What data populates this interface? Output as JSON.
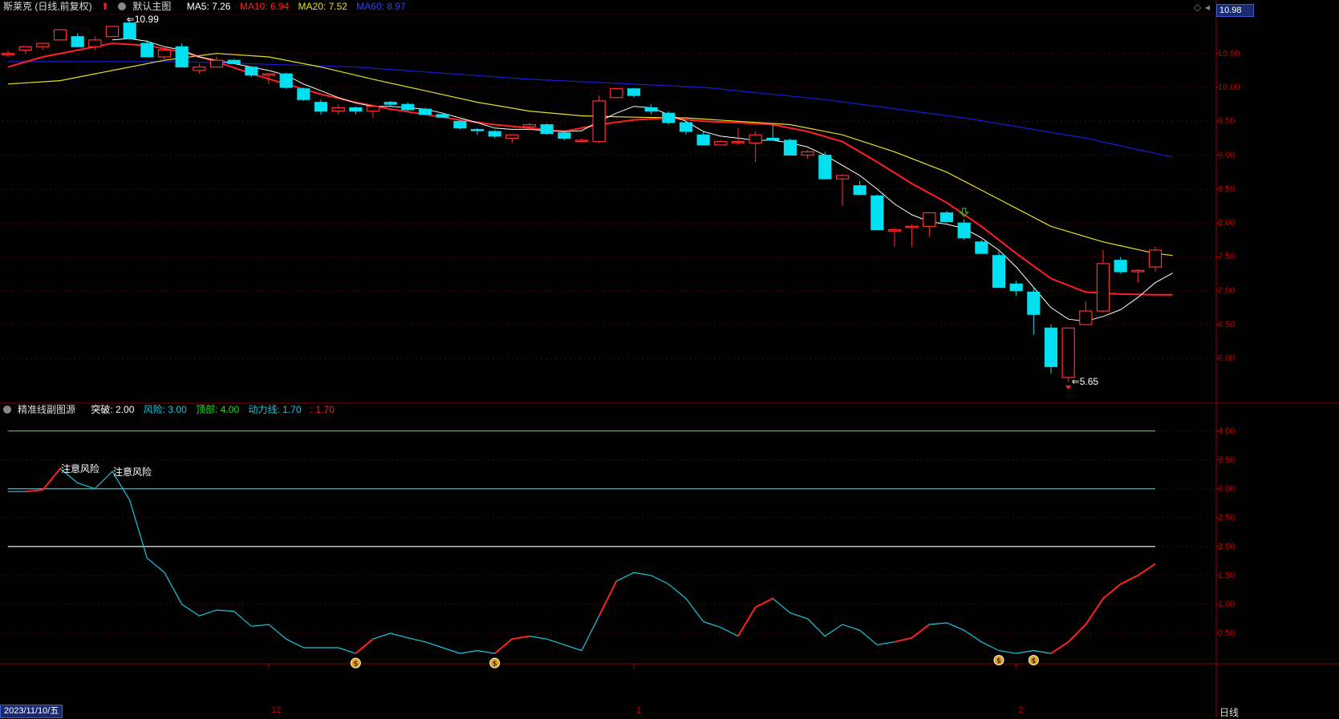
{
  "main_header": {
    "stock_name": "斯莱克 (日线,前复权)",
    "template": "默认主图",
    "ma5": "MA5: 7.26",
    "ma10": "MA10: 6.94",
    "ma20": "MA20: 7.52",
    "ma60": "MA60: 8.97"
  },
  "sub_header": {
    "indicator": "精准线副图源",
    "breakout": "突破: 2.00",
    "risk": "风险: 3.00",
    "top": "顶部: 4.00",
    "momentum": "动力线: 1.70",
    "extra": ": 1.70"
  },
  "current_price_tag": "10.98",
  "price_axis_labels": [
    "10.50",
    "10.00",
    "9.50",
    "9.00",
    "8.50",
    "8.00",
    "7.50",
    "7.00",
    "6.50",
    "6.00"
  ],
  "indicator_axis_labels": [
    "4.00",
    "3.50",
    "3.00",
    "2.50",
    "2.00",
    "1.50",
    "1.00",
    "0.50"
  ],
  "date_tag": "2023/11/10/五",
  "x_labels": [
    "12",
    "1",
    "2"
  ],
  "period_label": "日线",
  "annotations": {
    "high_label": "10.99",
    "low_label": "5.65",
    "risk_note_1": "注意风险",
    "risk_note_2": "注意风险"
  },
  "colors": {
    "ma5": "#ffffff",
    "ma10": "#ff2020",
    "ma20": "#e8e020",
    "ma60": "#1a1ad8",
    "up": "#ff3030",
    "down": "#00e0f0",
    "grid": "#5a0000"
  },
  "chart_data": {
    "type": "candlestick",
    "price_range": [
      5.4,
      11.1
    ],
    "indicator_range": [
      0.0,
      4.3
    ],
    "candles": [
      [
        10.5,
        10.55,
        10.45,
        10.5
      ],
      [
        10.55,
        10.6,
        10.5,
        10.6
      ],
      [
        10.6,
        10.65,
        10.55,
        10.65
      ],
      [
        10.7,
        10.85,
        10.7,
        10.85
      ],
      [
        10.75,
        10.8,
        10.6,
        10.6
      ],
      [
        10.6,
        10.75,
        10.55,
        10.7
      ],
      [
        10.75,
        10.9,
        10.75,
        10.9
      ],
      [
        10.95,
        10.99,
        10.7,
        10.72
      ],
      [
        10.65,
        10.7,
        10.45,
        10.45
      ],
      [
        10.45,
        10.6,
        10.4,
        10.55
      ],
      [
        10.6,
        10.65,
        10.3,
        10.3
      ],
      [
        10.25,
        10.35,
        10.2,
        10.3
      ],
      [
        10.3,
        10.45,
        10.3,
        10.4
      ],
      [
        10.4,
        10.42,
        10.35,
        10.35
      ],
      [
        10.3,
        10.32,
        10.15,
        10.18
      ],
      [
        10.18,
        10.2,
        10.05,
        10.2
      ],
      [
        10.2,
        10.22,
        9.98,
        10.0
      ],
      [
        9.98,
        10.0,
        9.8,
        9.82
      ],
      [
        9.78,
        9.82,
        9.6,
        9.65
      ],
      [
        9.65,
        9.75,
        9.6,
        9.7
      ],
      [
        9.7,
        9.72,
        9.6,
        9.65
      ],
      [
        9.65,
        9.72,
        9.55,
        9.72
      ],
      [
        9.78,
        9.8,
        9.72,
        9.75
      ],
      [
        9.75,
        9.78,
        9.65,
        9.67
      ],
      [
        9.68,
        9.7,
        9.6,
        9.6
      ],
      [
        9.6,
        9.62,
        9.55,
        9.56
      ],
      [
        9.5,
        9.52,
        9.38,
        9.4
      ],
      [
        9.38,
        9.4,
        9.3,
        9.36
      ],
      [
        9.35,
        9.37,
        9.25,
        9.28
      ],
      [
        9.25,
        9.3,
        9.18,
        9.3
      ],
      [
        9.42,
        9.48,
        9.36,
        9.45
      ],
      [
        9.45,
        9.47,
        9.3,
        9.32
      ],
      [
        9.33,
        9.35,
        9.22,
        9.25
      ],
      [
        9.22,
        9.25,
        9.18,
        9.22
      ],
      [
        9.2,
        9.88,
        9.18,
        9.8
      ],
      [
        9.85,
        9.98,
        9.85,
        9.98
      ],
      [
        9.98,
        9.99,
        9.85,
        9.88
      ],
      [
        9.7,
        9.75,
        9.6,
        9.65
      ],
      [
        9.62,
        9.65,
        9.45,
        9.48
      ],
      [
        9.48,
        9.5,
        9.3,
        9.35
      ],
      [
        9.3,
        9.35,
        9.15,
        9.15
      ],
      [
        9.15,
        9.22,
        9.15,
        9.2
      ],
      [
        9.2,
        9.4,
        9.15,
        9.2
      ],
      [
        9.18,
        9.35,
        8.9,
        9.3
      ],
      [
        9.25,
        9.48,
        9.22,
        9.22
      ],
      [
        9.22,
        9.25,
        9.0,
        9.0
      ],
      [
        9.0,
        9.08,
        8.95,
        9.05
      ],
      [
        9.0,
        9.05,
        8.65,
        8.65
      ],
      [
        8.65,
        8.72,
        8.25,
        8.7
      ],
      [
        8.55,
        8.62,
        8.42,
        8.42
      ],
      [
        8.4,
        8.42,
        7.9,
        7.9
      ],
      [
        7.88,
        7.92,
        7.65,
        7.9
      ],
      [
        7.95,
        7.98,
        7.65,
        7.95
      ],
      [
        7.95,
        8.15,
        7.8,
        8.15
      ],
      [
        8.15,
        8.18,
        8.0,
        8.02
      ],
      [
        8.0,
        8.05,
        7.75,
        7.78
      ],
      [
        7.72,
        7.75,
        7.55,
        7.55
      ],
      [
        7.52,
        7.58,
        7.05,
        7.05
      ],
      [
        7.1,
        7.15,
        6.92,
        7.0
      ],
      [
        6.98,
        7.05,
        6.35,
        6.65
      ],
      [
        6.45,
        6.5,
        5.78,
        5.88
      ],
      [
        5.72,
        6.45,
        5.65,
        6.45
      ],
      [
        6.5,
        6.85,
        6.5,
        6.7
      ],
      [
        6.7,
        7.6,
        6.68,
        7.4
      ],
      [
        7.45,
        7.5,
        7.25,
        7.28
      ],
      [
        7.28,
        7.32,
        7.12,
        7.3
      ],
      [
        7.35,
        7.65,
        7.28,
        7.6
      ]
    ],
    "ma5_points": [
      [
        6,
        10.7
      ],
      [
        7,
        10.72
      ],
      [
        8,
        10.68
      ],
      [
        9,
        10.6
      ],
      [
        10,
        10.55
      ],
      [
        11,
        10.45
      ],
      [
        12,
        10.4
      ],
      [
        13,
        10.35
      ],
      [
        14,
        10.3
      ],
      [
        15,
        10.25
      ],
      [
        16,
        10.18
      ],
      [
        17,
        10.05
      ],
      [
        18,
        9.95
      ],
      [
        19,
        9.85
      ],
      [
        20,
        9.77
      ],
      [
        21,
        9.72
      ],
      [
        22,
        9.72
      ],
      [
        23,
        9.7
      ],
      [
        24,
        9.68
      ],
      [
        25,
        9.62
      ],
      [
        26,
        9.55
      ],
      [
        27,
        9.48
      ],
      [
        28,
        9.4
      ],
      [
        29,
        9.38
      ],
      [
        30,
        9.38
      ],
      [
        31,
        9.36
      ],
      [
        32,
        9.35
      ],
      [
        33,
        9.36
      ],
      [
        34,
        9.5
      ],
      [
        35,
        9.62
      ],
      [
        36,
        9.72
      ],
      [
        37,
        9.7
      ],
      [
        38,
        9.6
      ],
      [
        39,
        9.5
      ],
      [
        40,
        9.35
      ],
      [
        41,
        9.28
      ],
      [
        42,
        9.25
      ],
      [
        43,
        9.22
      ],
      [
        44,
        9.22
      ],
      [
        45,
        9.18
      ],
      [
        46,
        9.12
      ],
      [
        47,
        9.0
      ],
      [
        48,
        8.85
      ],
      [
        49,
        8.7
      ],
      [
        50,
        8.5
      ],
      [
        51,
        8.28
      ],
      [
        52,
        8.12
      ],
      [
        53,
        8.02
      ],
      [
        54,
        7.98
      ],
      [
        55,
        7.92
      ],
      [
        56,
        7.78
      ],
      [
        57,
        7.6
      ],
      [
        58,
        7.35
      ],
      [
        59,
        7.05
      ],
      [
        60,
        6.75
      ],
      [
        61,
        6.58
      ],
      [
        62,
        6.55
      ],
      [
        63,
        6.62
      ],
      [
        64,
        6.72
      ],
      [
        65,
        6.9
      ],
      [
        66,
        7.12
      ],
      [
        67,
        7.26
      ]
    ],
    "ma10_points": [
      [
        0,
        10.3
      ],
      [
        2,
        10.45
      ],
      [
        4,
        10.55
      ],
      [
        6,
        10.65
      ],
      [
        8,
        10.62
      ],
      [
        10,
        10.52
      ],
      [
        12,
        10.38
      ],
      [
        14,
        10.2
      ],
      [
        16,
        10.05
      ],
      [
        18,
        9.9
      ],
      [
        20,
        9.78
      ],
      [
        22,
        9.68
      ],
      [
        24,
        9.6
      ],
      [
        26,
        9.52
      ],
      [
        28,
        9.45
      ],
      [
        30,
        9.4
      ],
      [
        32,
        9.35
      ],
      [
        34,
        9.45
      ],
      [
        36,
        9.52
      ],
      [
        38,
        9.55
      ],
      [
        40,
        9.5
      ],
      [
        42,
        9.48
      ],
      [
        44,
        9.45
      ],
      [
        46,
        9.35
      ],
      [
        48,
        9.2
      ],
      [
        50,
        8.9
      ],
      [
        52,
        8.58
      ],
      [
        54,
        8.3
      ],
      [
        56,
        7.95
      ],
      [
        58,
        7.55
      ],
      [
        60,
        7.18
      ],
      [
        62,
        6.98
      ],
      [
        64,
        6.95
      ],
      [
        66,
        6.94
      ],
      [
        67,
        6.94
      ]
    ],
    "ma20_points": [
      [
        0,
        10.05
      ],
      [
        3,
        10.1
      ],
      [
        6,
        10.25
      ],
      [
        9,
        10.4
      ],
      [
        12,
        10.5
      ],
      [
        15,
        10.45
      ],
      [
        18,
        10.3
      ],
      [
        21,
        10.12
      ],
      [
        24,
        9.95
      ],
      [
        27,
        9.78
      ],
      [
        30,
        9.65
      ],
      [
        33,
        9.58
      ],
      [
        36,
        9.56
      ],
      [
        39,
        9.55
      ],
      [
        42,
        9.5
      ],
      [
        45,
        9.45
      ],
      [
        48,
        9.3
      ],
      [
        51,
        9.05
      ],
      [
        54,
        8.75
      ],
      [
        57,
        8.35
      ],
      [
        60,
        7.95
      ],
      [
        63,
        7.72
      ],
      [
        66,
        7.55
      ],
      [
        67,
        7.52
      ]
    ],
    "ma60_points": [
      [
        0,
        10.38
      ],
      [
        10,
        10.38
      ],
      [
        20,
        10.3
      ],
      [
        30,
        10.12
      ],
      [
        40,
        10.0
      ],
      [
        47,
        9.82
      ],
      [
        55,
        9.55
      ],
      [
        62,
        9.25
      ],
      [
        67,
        8.97
      ]
    ],
    "indicator_line": [
      2.95,
      2.95,
      2.98,
      3.35,
      3.1,
      3.0,
      3.3,
      2.8,
      1.8,
      1.55,
      1.0,
      0.8,
      0.9,
      0.88,
      0.62,
      0.65,
      0.4,
      0.25,
      0.25,
      0.25,
      0.15,
      0.4,
      0.5,
      0.42,
      0.35,
      0.25,
      0.15,
      0.2,
      0.15,
      0.4,
      0.45,
      0.4,
      0.3,
      0.2,
      0.8,
      1.4,
      1.55,
      1.5,
      1.35,
      1.1,
      0.7,
      0.6,
      0.45,
      0.95,
      1.1,
      0.85,
      0.75,
      0.45,
      0.65,
      0.55,
      0.3,
      0.35,
      0.42,
      0.65,
      0.68,
      0.55,
      0.35,
      0.2,
      0.15,
      0.2,
      0.15,
      0.35,
      0.65,
      1.1,
      1.35,
      1.5,
      1.7
    ],
    "indicator_red_segments": [
      [
        1,
        3
      ],
      [
        20,
        21
      ],
      [
        28,
        30
      ],
      [
        34,
        35
      ],
      [
        42,
        44
      ],
      [
        51,
        53
      ],
      [
        60,
        66
      ]
    ],
    "reference_lines": {
      "top": 4.0,
      "risk": 3.0,
      "breakout": 2.0
    },
    "money_markers": [
      20,
      28,
      57,
      59
    ]
  }
}
